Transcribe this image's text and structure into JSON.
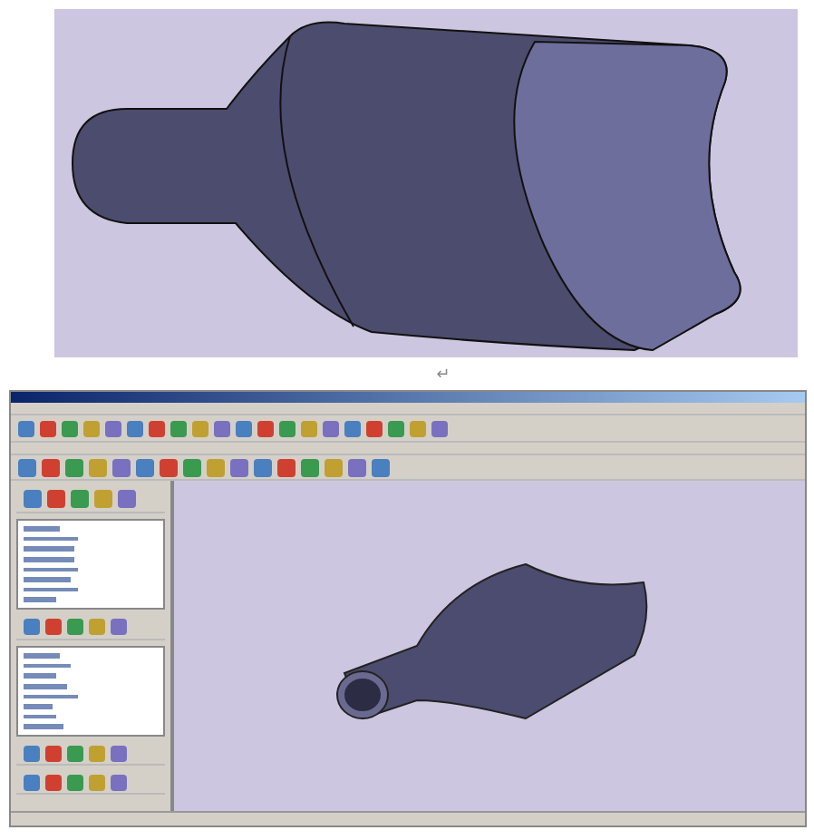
{
  "document": {
    "paragraph_mark": "↵"
  }
}
